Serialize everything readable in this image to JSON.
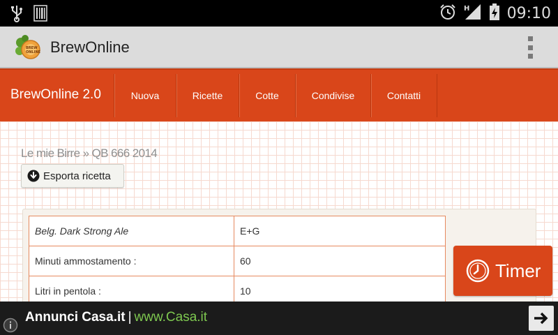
{
  "status_bar": {
    "time": "09:10",
    "icons": [
      "usb-icon",
      "barcode-icon",
      "alarm-icon",
      "signal-h-icon",
      "battery-charging-icon"
    ]
  },
  "action_bar": {
    "title": "BrewOnline",
    "logo_icon": "brewonline-logo-icon",
    "menu_icon": "overflow-menu-icon"
  },
  "site_nav": {
    "brand": "BrewOnline 2.0",
    "items": [
      "Nuova",
      "Ricette",
      "Cotte",
      "Condivise",
      "Contatti"
    ]
  },
  "breadcrumb": "Le mie Birre » QB 666 2014",
  "export_button": {
    "label": "Esporta ricetta",
    "icon": "download-circle-icon"
  },
  "recipe_rows": [
    {
      "label": "Belg. Dark Strong Ale",
      "value": "E+G"
    },
    {
      "label": "Minuti ammostamento :",
      "value": "60"
    },
    {
      "label": "Litri in pentola :",
      "value": "10"
    }
  ],
  "timer_button": {
    "label": "Timer",
    "icon": "clock-icon"
  },
  "ad": {
    "title": "Annunci Casa.it",
    "separator": "|",
    "url": "www.Casa.it",
    "info_icon": "info-icon",
    "arrow_icon": "arrow-right-icon"
  },
  "colors": {
    "accent": "#d9461a",
    "table_border": "#e6895e",
    "ad_url": "#7ec850"
  }
}
